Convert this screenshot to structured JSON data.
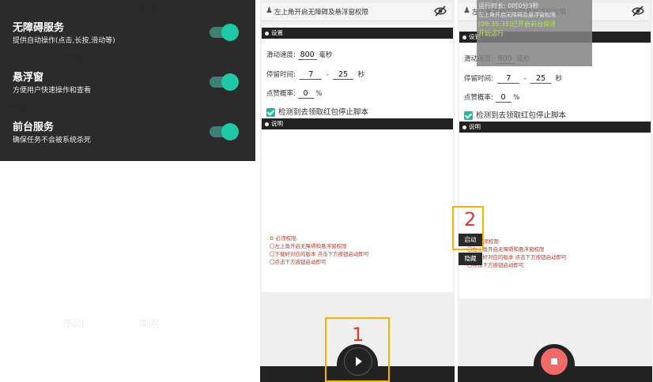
{
  "left_panel": {
    "services": [
      {
        "title": "无障碍服务",
        "desc": "提供自动操作(点击,长按,滑动等)",
        "enabled": true
      },
      {
        "title": "悬浮窗",
        "desc": "方便用户快速操作和查看",
        "enabled": true
      },
      {
        "title": "前台服务",
        "desc": "确保任务不会被系统杀死",
        "enabled": true
      }
    ]
  },
  "screen": {
    "top_hint": "左上角开启无障碍及悬浮窗权限",
    "settings_header": "设置",
    "scroll_speed_label": "滑动速度:",
    "scroll_speed_value": "800",
    "scroll_speed_unit": "毫秒",
    "stay_label": "停留时间:",
    "stay_min": "7",
    "stay_sep": "-",
    "stay_max": "25",
    "stay_unit": "秒",
    "like_label": "点赞概率:",
    "like_value": "0",
    "like_unit": "%",
    "stop_checkbox_label": "检测到去领取红包停止脚本",
    "desc_header": "说明",
    "perm_title": "必须权限:",
    "perm_lines": [
      "〇左上角开启无障碍和悬浮窗权限",
      "〇下载好对应的版本 点击下方按钮启动即可",
      "〇点击下方按钮启动即可"
    ]
  },
  "overlay": {
    "runtime": "运行时长: 0时0分3秒",
    "line2": "左上角开启无障碍及悬浮窗权限",
    "log1": "[09:35:35]已开启前台保活",
    "log2": "开始运行"
  },
  "buttons": {
    "start": "启动",
    "hide": "隐藏"
  },
  "annotations": {
    "step1": "1",
    "step2": "2"
  },
  "watermark": "李刚",
  "colors": {
    "accent": "#1fc8a6",
    "stop": "#f06a6a",
    "highlight": "#f5b400",
    "step_number": "#e23b2c"
  }
}
